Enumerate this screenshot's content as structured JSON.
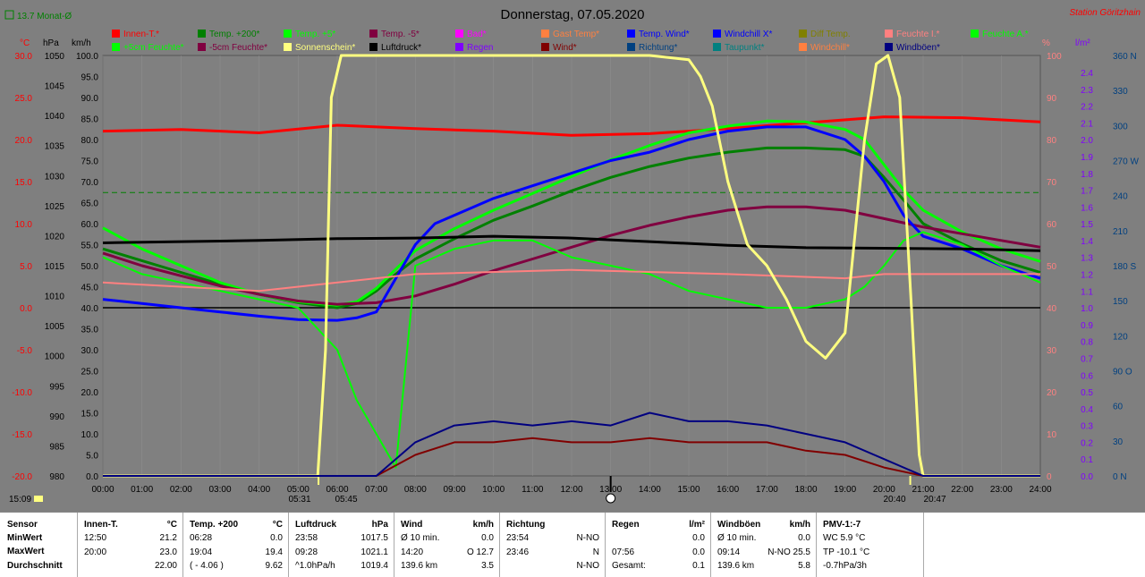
{
  "title": "Donnerstag, 07.05.2020",
  "station": "Station Göritzhain",
  "top_left_note": "13.7 Monat-Ø",
  "colors": {
    "background": "#7f7f7f",
    "plot_bg": "#808080",
    "innen": "#ff0000",
    "temp200": "#008000",
    "temp5": "#00ff00",
    "tempm5": "#800040",
    "bad": "#ff00ff",
    "gast": "#ff8040",
    "wind_temp": "#0000ff",
    "windchill": "#0000ff",
    "diff": "#808000",
    "feuchte_i": "#ff8080",
    "feuchte_a": "#00ff00",
    "sun": "#ffff80",
    "luftdruck": "#000000",
    "regen": "#8000ff",
    "wind": "#800000",
    "richtung": "#004080",
    "taupunkt": "#008080",
    "windboen": "#000080"
  },
  "legend": [
    {
      "label": "Innen-T.*",
      "color": "#ff0000"
    },
    {
      "label": "Temp. +200*",
      "color": "#008000"
    },
    {
      "label": "Temp. +5*",
      "color": "#00ff00"
    },
    {
      "label": "Temp. -5*",
      "color": "#800040"
    },
    {
      "label": "Bad*",
      "color": "#ff00ff"
    },
    {
      "label": "Gast Temp*",
      "color": "#ff8040"
    },
    {
      "label": "Temp. Wind*",
      "color": "#0000ff"
    },
    {
      "label": "Windchill X*",
      "color": "#0000ff"
    },
    {
      "label": "Diff Temp.",
      "color": "#808000"
    },
    {
      "label": "Feuchte I.*",
      "color": "#ff8080"
    },
    {
      "label": "Feuchte A.*",
      "color": "#00ff00"
    },
    {
      "label": "+5cm Feuchte*",
      "color": "#00ff00"
    },
    {
      "label": "-5cm Feuchte*",
      "color": "#800040"
    },
    {
      "label": "Sonnenschein*",
      "color": "#ffff80"
    },
    {
      "label": "Luftdruck*",
      "color": "#000000"
    },
    {
      "label": "Regen",
      "color": "#8000ff"
    },
    {
      "label": "Wind*",
      "color": "#800000"
    },
    {
      "label": "Richtung*",
      "color": "#004080"
    },
    {
      "label": "Taupunkt*",
      "color": "#008080"
    },
    {
      "label": "Windchill*",
      "color": "#ff8040"
    },
    {
      "label": "Windböen*",
      "color": "#000080"
    }
  ],
  "axes_units": {
    "celsius": "°C",
    "hpa": "hPa",
    "kmh": "km/h",
    "percent": "%",
    "rain": "l/m²"
  },
  "axis_celsius": [
    "30.0",
    "25.0",
    "20.0",
    "15.0",
    "10.0",
    "5.0",
    "0.0",
    "-5.0",
    "-10.0",
    "-15.0",
    "-20.0"
  ],
  "axis_hpa": [
    "1050",
    "1045",
    "1040",
    "1035",
    "1030",
    "1025",
    "1020",
    "1015",
    "1010",
    "1005",
    "1000",
    "995",
    "990",
    "985",
    "980"
  ],
  "axis_kmh": [
    "100.0",
    "95.0",
    "90.0",
    "85.0",
    "80.0",
    "75.0",
    "70.0",
    "65.0",
    "60.0",
    "55.0",
    "50.0",
    "45.0",
    "40.0",
    "35.0",
    "30.0",
    "25.0",
    "20.0",
    "15.0",
    "10.0",
    "5.0",
    "0.0"
  ],
  "axis_percent": [
    "100",
    "90",
    "80",
    "70",
    "60",
    "50",
    "40",
    "30",
    "20",
    "10",
    "0"
  ],
  "axis_rain": [
    "2.4",
    "2.3",
    "2.2",
    "2.1",
    "2.0",
    "1.9",
    "1.8",
    "1.7",
    "1.6",
    "1.5",
    "1.4",
    "1.3",
    "1.2",
    "1.1",
    "1.0",
    "0.9",
    "0.8",
    "0.7",
    "0.6",
    "0.5",
    "0.4",
    "0.3",
    "0.2",
    "0.1",
    "0.0"
  ],
  "axis_direction": [
    "360 N",
    "330",
    "300",
    "270 W",
    "240",
    "210",
    "180 S",
    "150",
    "120",
    "90 O",
    "60",
    "30",
    "0 N"
  ],
  "time_ticks": [
    "00:00",
    "01:00",
    "02:00",
    "03:00",
    "04:00",
    "05:00",
    "06:00",
    "07:00",
    "08:00",
    "09:00",
    "10:00",
    "11:00",
    "12:00",
    "13:00",
    "14:00",
    "15:00",
    "16:00",
    "17:00",
    "18:00",
    "19:00",
    "20:00",
    "21:00",
    "22:00",
    "23:00",
    "24:00"
  ],
  "sun_times": {
    "rise_label": "05:31",
    "rise2_label": "05:45",
    "set_label": "20:40",
    "set2_label": "20:47",
    "now_label": "15:09"
  },
  "chart_data": {
    "type": "line",
    "title": "Donnerstag, 07.05.2020",
    "x_unit": "hours",
    "x_range": [
      0,
      24
    ],
    "temperature_range_c": [
      -20,
      30
    ],
    "pressure_range_hpa": [
      980,
      1050
    ],
    "wind_range_kmh": [
      0,
      100
    ],
    "series": [
      {
        "name": "Innen-T.*",
        "axis": "celsius",
        "color": "#ff0000",
        "x": [
          0,
          2,
          4,
          6,
          8,
          10,
          12,
          14,
          16,
          18,
          20,
          22,
          24
        ],
        "y": [
          21.0,
          21.2,
          20.8,
          21.7,
          21.3,
          21.0,
          20.5,
          20.7,
          21.3,
          22.0,
          22.7,
          22.6,
          22.1
        ]
      },
      {
        "name": "Temp. +200*",
        "axis": "celsius",
        "color": "#008000",
        "x": [
          0,
          1,
          2,
          3,
          4,
          5,
          6,
          6.5,
          7,
          7.5,
          8,
          9,
          10,
          11,
          12,
          13,
          14,
          15,
          16,
          17,
          18,
          19,
          19.5,
          20,
          20.5,
          21,
          22,
          23,
          24
        ],
        "y": [
          7.0,
          5.6,
          4.2,
          2.8,
          1.6,
          0.6,
          0.0,
          0.5,
          2.0,
          4.0,
          5.8,
          8.2,
          10.4,
          12.1,
          13.9,
          15.5,
          16.8,
          17.8,
          18.5,
          19.0,
          19.0,
          18.8,
          18.0,
          15.5,
          12.8,
          10.0,
          7.6,
          5.6,
          4.2
        ]
      },
      {
        "name": "Temp. +5*",
        "axis": "celsius",
        "color": "#00ff00",
        "x": [
          0,
          1,
          2,
          3,
          4,
          5,
          6,
          6.5,
          7,
          7.5,
          8,
          9,
          10,
          11,
          12,
          13,
          14,
          15,
          16,
          17,
          18,
          19,
          19.5,
          20,
          20.5,
          21,
          22,
          23,
          24
        ],
        "y": [
          9.5,
          7.0,
          5.0,
          3.0,
          1.6,
          0.7,
          0.3,
          0.7,
          2.3,
          4.6,
          6.8,
          9.4,
          11.6,
          13.6,
          15.6,
          17.6,
          19.3,
          20.8,
          21.6,
          22.2,
          22.1,
          21.2,
          20.0,
          17.0,
          14.0,
          11.6,
          9.0,
          7.0,
          5.5
        ]
      },
      {
        "name": "Temp. -5*",
        "axis": "celsius",
        "color": "#800040",
        "x": [
          0,
          1,
          2,
          3,
          4,
          5,
          6,
          7,
          8,
          9,
          10,
          11,
          12,
          13,
          14,
          15,
          16,
          17,
          18,
          19,
          20,
          21,
          22,
          23,
          24
        ],
        "y": [
          6.5,
          5.0,
          3.8,
          2.6,
          1.6,
          0.8,
          0.4,
          0.6,
          1.4,
          2.8,
          4.4,
          5.8,
          7.2,
          8.6,
          9.8,
          10.8,
          11.6,
          12.0,
          12.0,
          11.6,
          10.6,
          9.6,
          8.8,
          8.0,
          7.2
        ]
      },
      {
        "name": "Temp. Wind*",
        "axis": "celsius",
        "color": "#0000ff",
        "x": [
          0,
          1,
          2,
          3,
          4,
          5,
          6,
          6.5,
          7,
          7.5,
          8,
          8.5,
          9,
          10,
          11,
          12,
          13,
          14,
          15,
          16,
          17,
          18,
          19,
          19.5,
          20,
          20.5,
          21,
          22,
          23,
          24
        ],
        "y": [
          1.0,
          0.5,
          0.0,
          -0.5,
          -1.0,
          -1.4,
          -1.5,
          -1.2,
          -0.5,
          3.5,
          7.5,
          10.0,
          11.0,
          13.0,
          14.5,
          16.0,
          17.5,
          18.5,
          20.0,
          21.0,
          21.5,
          21.5,
          20.0,
          18.0,
          15.0,
          11.0,
          8.5,
          7.0,
          5.0,
          3.5
        ]
      },
      {
        "name": "Feuchte A.*",
        "axis": "percent",
        "color": "#00ff00",
        "x": [
          0,
          1,
          2,
          3,
          4,
          5,
          6,
          6.5,
          7,
          7.5,
          8,
          9,
          10,
          11,
          12,
          13,
          14,
          15,
          16,
          17,
          18,
          19,
          19.5,
          20,
          20.5,
          21,
          22,
          23,
          24
        ],
        "y": [
          52,
          48,
          46,
          44,
          42,
          40,
          30,
          18,
          10,
          2,
          50,
          54,
          56,
          56,
          52,
          50,
          48,
          44,
          42,
          40,
          40,
          42,
          45,
          50,
          56,
          58,
          55,
          50,
          46
        ]
      },
      {
        "name": "Feuchte I.*",
        "axis": "percent",
        "color": "#ff8080",
        "x": [
          0,
          4,
          8,
          12,
          16,
          19,
          20,
          24
        ],
        "y": [
          46,
          44,
          48,
          49,
          48,
          47,
          48,
          48
        ]
      },
      {
        "name": "Luftdruck*",
        "axis": "hpa",
        "color": "#000000",
        "x": [
          0,
          2,
          4,
          6,
          8,
          10,
          12,
          14,
          16,
          18,
          20,
          22,
          24
        ],
        "y": [
          1018.8,
          1019.0,
          1019.2,
          1019.5,
          1019.6,
          1019.9,
          1019.6,
          1019.0,
          1018.4,
          1018.0,
          1017.9,
          1017.8,
          1017.5
        ]
      },
      {
        "name": "Sonnenschein*",
        "axis": "percent",
        "color": "#ffff80",
        "x": [
          0,
          5.5,
          5.7,
          5.85,
          6.1,
          7,
          12,
          14,
          15,
          15.3,
          15.6,
          16,
          16.5,
          17,
          17.5,
          18,
          18.5,
          19,
          19.5,
          19.8,
          20.1,
          20.4,
          20.7,
          20.9,
          21,
          24
        ],
        "y": [
          0,
          0,
          30,
          90,
          100,
          100,
          100,
          100,
          99,
          95,
          88,
          70,
          55,
          50,
          42,
          32,
          28,
          34,
          80,
          98,
          100,
          90,
          40,
          5,
          0,
          0
        ]
      },
      {
        "name": "Wind*",
        "axis": "kmh",
        "color": "#800000",
        "x": [
          0,
          7,
          8,
          9,
          10,
          11,
          12,
          13,
          14,
          15,
          16,
          17,
          18,
          19,
          20,
          21,
          24
        ],
        "y": [
          0,
          0,
          5,
          8,
          8,
          9,
          8,
          8,
          9,
          8,
          8,
          8,
          6,
          5,
          2,
          0,
          0
        ]
      },
      {
        "name": "Windböen*",
        "axis": "kmh",
        "color": "#000080",
        "x": [
          0,
          7,
          8,
          9,
          10,
          11,
          12,
          13,
          14,
          15,
          16,
          17,
          18,
          19,
          20,
          21,
          24
        ],
        "y": [
          0,
          0,
          8,
          12,
          13,
          12,
          13,
          12,
          15,
          13,
          13,
          12,
          10,
          8,
          4,
          0,
          0
        ]
      }
    ]
  },
  "stats": {
    "sensor": {
      "title": "Sensor",
      "rows": [
        "MinWert",
        "MaxWert",
        "Durchschnitt"
      ]
    },
    "innen": {
      "title": "Innen-T.",
      "unit": "°C",
      "rows": [
        [
          "12:50",
          "21.2"
        ],
        [
          "20:00",
          "23.0"
        ],
        [
          "",
          "22.00"
        ]
      ]
    },
    "temp200": {
      "title": "Temp. +200",
      "unit": "°C",
      "rows": [
        [
          "06:28",
          "0.0"
        ],
        [
          "19:04",
          "19.4"
        ],
        [
          "( - 4.06 )",
          "9.62"
        ]
      ]
    },
    "luftdruck": {
      "title": "Luftdruck",
      "unit": "hPa",
      "rows": [
        [
          "23:58",
          "1017.5"
        ],
        [
          "09:28",
          "1021.1"
        ],
        [
          "^1.0hPa/h",
          "1019.4"
        ]
      ]
    },
    "wind": {
      "title": "Wind",
      "unit": "km/h",
      "rows": [
        [
          "Ø 10 min.",
          "0.0"
        ],
        [
          "14:20",
          "O 12.7"
        ],
        [
          "139.6 km",
          "3.5"
        ]
      ]
    },
    "richtung": {
      "title": "Richtung",
      "rows": [
        [
          "23:54",
          "N-NO"
        ],
        [
          "23:46",
          "N"
        ],
        [
          "",
          "N-NO"
        ]
      ]
    },
    "regen": {
      "title": "Regen",
      "unit": "l/m²",
      "rows": [
        [
          "",
          "0.0"
        ],
        [
          "07:56",
          "0.0"
        ],
        [
          "Gesamt:",
          "0.1"
        ]
      ]
    },
    "windboen": {
      "title": "Windböen",
      "unit": "km/h",
      "rows": [
        [
          "Ø 10 min.",
          "0.0"
        ],
        [
          "09:14",
          "N-NO 25.5"
        ],
        [
          "139.6 km",
          "5.8"
        ]
      ]
    },
    "pmv": {
      "title": "PMV-1:-7",
      "rows": [
        "WC 5.9 °C",
        "TP -10.1 °C",
        "-0.7hPa/3h"
      ]
    }
  }
}
